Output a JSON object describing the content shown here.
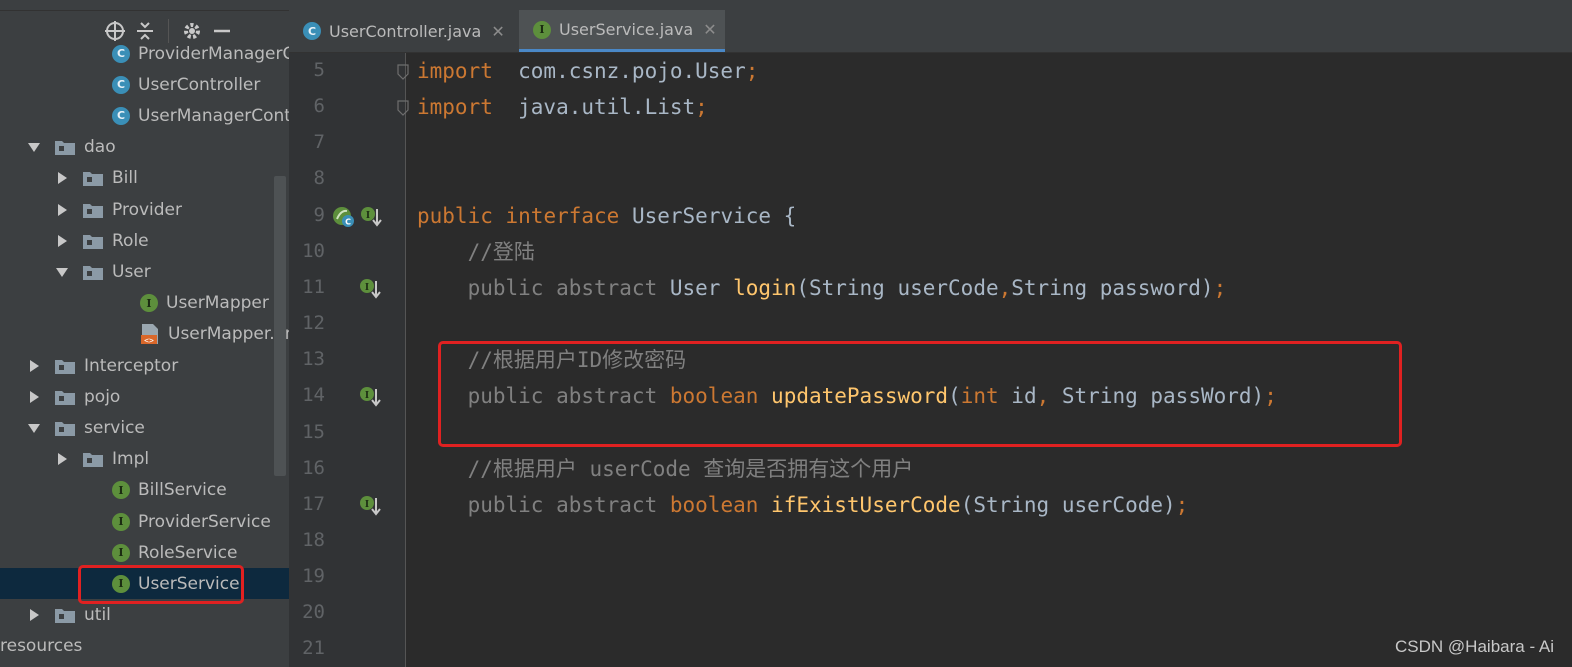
{
  "sidebar": {
    "toolbar_icons": [
      "crosshair-icon",
      "collapse-icon",
      "gear-icon",
      "minimize-icon"
    ],
    "items": [
      {
        "label": "ProviderManagerCon",
        "type": "class",
        "indent": 3,
        "arrow": "none"
      },
      {
        "label": "UserController",
        "type": "class",
        "indent": 3,
        "arrow": "none"
      },
      {
        "label": "UserManagerControll",
        "type": "class",
        "indent": 3,
        "arrow": "none"
      },
      {
        "label": "dao",
        "type": "package",
        "indent": 1,
        "arrow": "expanded"
      },
      {
        "label": "Bill",
        "type": "package",
        "indent": 2,
        "arrow": "collapsed"
      },
      {
        "label": "Provider",
        "type": "package",
        "indent": 2,
        "arrow": "collapsed"
      },
      {
        "label": "Role",
        "type": "package",
        "indent": 2,
        "arrow": "collapsed"
      },
      {
        "label": "User",
        "type": "package",
        "indent": 2,
        "arrow": "expanded"
      },
      {
        "label": "UserMapper",
        "type": "interface",
        "indent": 4,
        "arrow": "none"
      },
      {
        "label": "UserMapper.xml",
        "type": "xml",
        "indent": 4,
        "arrow": "none"
      },
      {
        "label": "Interceptor",
        "type": "package",
        "indent": 1,
        "arrow": "collapsed"
      },
      {
        "label": "pojo",
        "type": "package",
        "indent": 1,
        "arrow": "collapsed"
      },
      {
        "label": "service",
        "type": "package",
        "indent": 1,
        "arrow": "expanded"
      },
      {
        "label": "Impl",
        "type": "package",
        "indent": 2,
        "arrow": "collapsed"
      },
      {
        "label": "BillService",
        "type": "interface",
        "indent": 3,
        "arrow": "none"
      },
      {
        "label": "ProviderService",
        "type": "interface",
        "indent": 3,
        "arrow": "none"
      },
      {
        "label": "RoleService",
        "type": "interface",
        "indent": 3,
        "arrow": "none"
      },
      {
        "label": "UserService",
        "type": "interface",
        "indent": 3,
        "arrow": "none",
        "selected": true
      },
      {
        "label": "util",
        "type": "package",
        "indent": 1,
        "arrow": "collapsed"
      },
      {
        "label": "resources",
        "type": "folder",
        "indent": 0,
        "arrow": "none"
      }
    ]
  },
  "tabs": [
    {
      "label": "UserController.java",
      "type": "class",
      "active": false
    },
    {
      "label": "UserService.java",
      "type": "interface",
      "active": true
    }
  ],
  "editor": {
    "lines": [
      {
        "no": "5",
        "tokens": [
          [
            "kw",
            "import"
          ],
          [
            "",
            "  com.csnz.pojo.User"
          ],
          [
            "pn",
            ";"
          ]
        ],
        "fold": true
      },
      {
        "no": "6",
        "tokens": [
          [
            "kw",
            "import"
          ],
          [
            "",
            "  java.util.List"
          ],
          [
            "pn",
            ";"
          ]
        ],
        "fold": true
      },
      {
        "no": "7",
        "tokens": []
      },
      {
        "no": "8",
        "tokens": []
      },
      {
        "no": "9",
        "tokens": [
          [
            "kw",
            "public"
          ],
          [
            "",
            " "
          ],
          [
            "kw",
            "interface"
          ],
          [
            "",
            " UserService {"
          ]
        ],
        "mark": "spring-impl"
      },
      {
        "no": "10",
        "tokens": [
          [
            "cm",
            "    //登陆"
          ]
        ]
      },
      {
        "no": "11",
        "tokens": [
          [
            "kw-gray",
            "    public abstract "
          ],
          [
            "",
            "User "
          ],
          [
            "fn",
            "login"
          ],
          [
            "",
            "(String userCode"
          ],
          [
            "pn",
            ","
          ],
          [
            "",
            "String password)"
          ],
          [
            "pn",
            ";"
          ]
        ],
        "mark": "impl"
      },
      {
        "no": "12",
        "tokens": []
      },
      {
        "no": "13",
        "tokens": [
          [
            "cm",
            "    //根据用户ID修改密码"
          ]
        ]
      },
      {
        "no": "14",
        "tokens": [
          [
            "kw-gray",
            "    public abstract "
          ],
          [
            "kw",
            "boolean"
          ],
          [
            "",
            " "
          ],
          [
            "fn",
            "updatePassword"
          ],
          [
            "",
            "("
          ],
          [
            "kw",
            "int"
          ],
          [
            "",
            " id"
          ],
          [
            "pn",
            ","
          ],
          [
            "",
            " String passWord)"
          ],
          [
            "pn",
            ";"
          ]
        ],
        "mark": "impl"
      },
      {
        "no": "15",
        "tokens": []
      },
      {
        "no": "16",
        "tokens": [
          [
            "cm",
            "    //根据用户 userCode 查询是否拥有这个用户"
          ]
        ]
      },
      {
        "no": "17",
        "tokens": [
          [
            "kw-gray",
            "    public abstract "
          ],
          [
            "kw",
            "boolean"
          ],
          [
            "",
            " "
          ],
          [
            "fn",
            "ifExistUserCode"
          ],
          [
            "",
            "(String userCode)"
          ],
          [
            "pn",
            ";"
          ]
        ],
        "mark": "impl"
      },
      {
        "no": "18",
        "tokens": []
      },
      {
        "no": "19",
        "tokens": []
      },
      {
        "no": "20",
        "tokens": []
      },
      {
        "no": "21",
        "tokens": []
      }
    ]
  },
  "watermark": "CSDN @Haibara - Ai",
  "colors": {
    "highlight": "#e02121",
    "keyword": "#cc7832",
    "function": "#ffc66d",
    "comment": "#808080",
    "text": "#a9b7c6"
  }
}
